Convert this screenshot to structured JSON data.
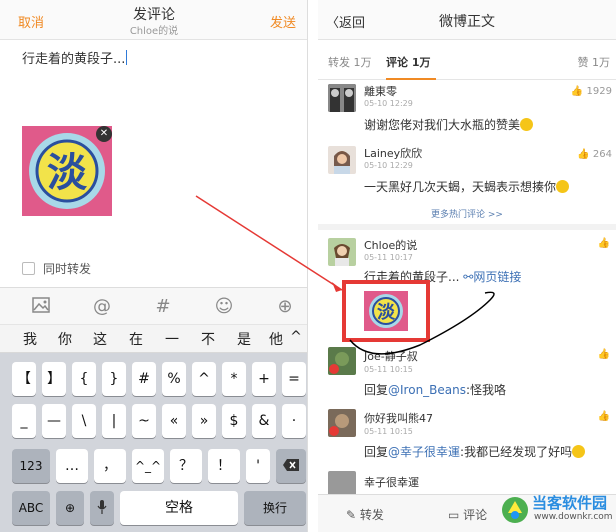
{
  "composer": {
    "cancel": "取消",
    "title": "发评论",
    "subtitle": "Chloe的说",
    "send": "发送",
    "text": "行走着的黄段子...",
    "repost_label": "同时转发",
    "image_text": "淡"
  },
  "toolbar": {
    "icons": [
      "image-icon",
      "at-icon",
      "hashtag-icon",
      "emoji-icon",
      "plus-icon"
    ]
  },
  "keyboard": {
    "candidates": [
      "我",
      "你",
      "这",
      "在",
      "一",
      "不",
      "是",
      "他",
      "^"
    ],
    "row1": [
      "【",
      "】",
      "{",
      "}",
      "#",
      "%",
      "^",
      "*",
      "+",
      "="
    ],
    "row2": [
      "_",
      "—",
      "\\",
      "|",
      "~",
      "«",
      "»",
      "$",
      "&",
      "·"
    ],
    "row3": [
      "123",
      "…",
      "，",
      "^_^",
      "？",
      "！",
      "'"
    ],
    "row4": [
      "ABC",
      "空格",
      "换行"
    ]
  },
  "weibo": {
    "back": "返回",
    "title": "微博正文",
    "tabs": {
      "repost": "转发 1万",
      "comment": "评论 1万",
      "likes": "赞 1万"
    },
    "more_hot": "更多热门评论 >>",
    "comments": [
      {
        "name": "離東零",
        "time": "05-10 12:29",
        "text": "谢谢您佬对我们大水瓶的赞美",
        "likes": "1929"
      },
      {
        "name": "Lainey欣欣",
        "time": "05-10 12:29",
        "text": "一天黑好几次天蝎，天蝎表示想揍你",
        "likes": "264"
      },
      {
        "name": "Chloe的说",
        "time": "05-11 10:17",
        "text": "行走着的黄段子...",
        "link": "网页链接"
      },
      {
        "name": "Joe-静子叔",
        "time": "05-11 10:15",
        "reply_prefix": "回复",
        "mention": "@Iron_Beans",
        "text": ":怪我咯"
      },
      {
        "name": "你好我叫熊47",
        "time": "05-11 10:15",
        "reply_prefix": "回复",
        "mention": "@幸子很幸運",
        "text": ":我都已经发现了好吗"
      },
      {
        "name": "幸子很幸運",
        "time": ""
      }
    ],
    "bottom": {
      "repost": "转发",
      "comment": "评论"
    }
  },
  "watermark": {
    "title": "当客软件园",
    "url": "www.downkr.com"
  },
  "colors": {
    "accent": "#f08a24",
    "link": "#3b6fb4",
    "annotation": "#e53935"
  }
}
